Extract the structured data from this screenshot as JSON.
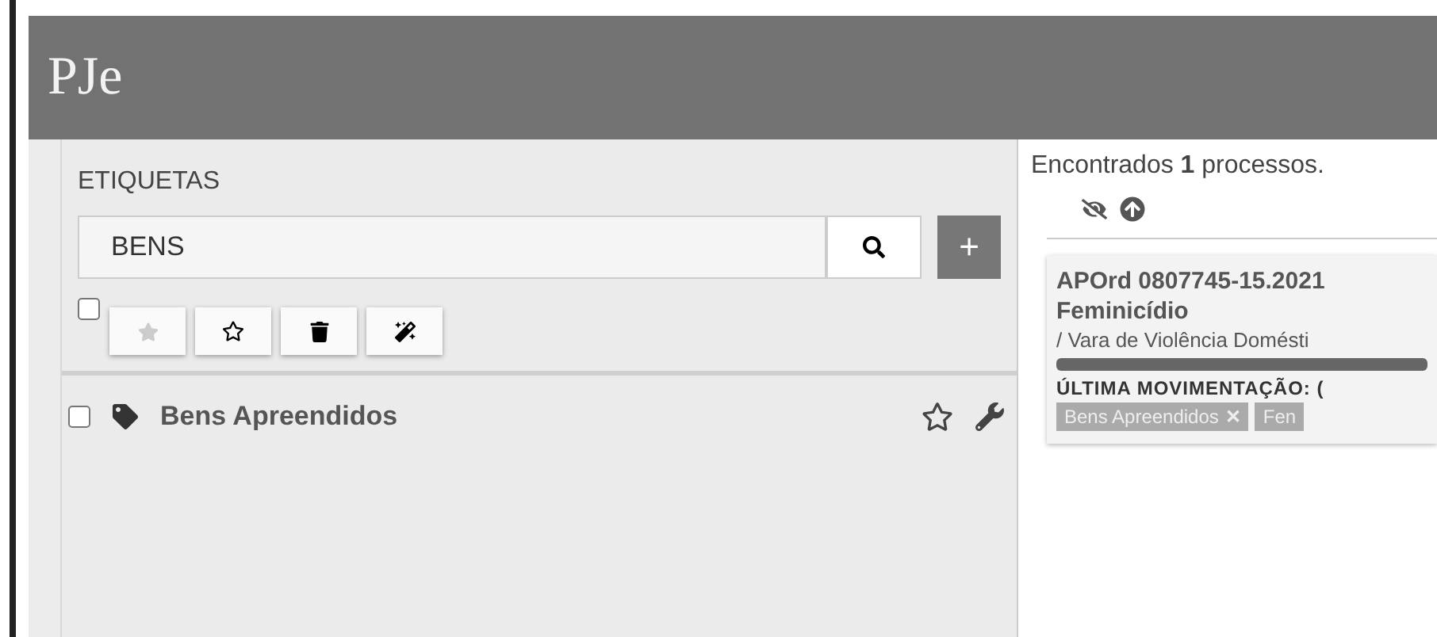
{
  "header": {
    "logo": "PJe"
  },
  "labels_panel": {
    "title": "ETIQUETAS",
    "search": {
      "value": "BENS"
    },
    "add_button": "+",
    "select_all": {
      "checked": false
    },
    "items": [
      {
        "name": "Bens Apreendidos",
        "checked": false
      }
    ]
  },
  "results": {
    "summary": "Encontrados **1** processos.",
    "card": {
      "title": "APOrd 0807745-15.2021",
      "subject": "Feminicídio",
      "court": "/ Vara de Violência Domésti",
      "last_move": "ÚLTIMA MOVIMENTAÇÃO: (",
      "tags": [
        {
          "label": "Bens Apreendidos",
          "remove": "✕"
        },
        {
          "label": "Fen"
        }
      ]
    }
  }
}
